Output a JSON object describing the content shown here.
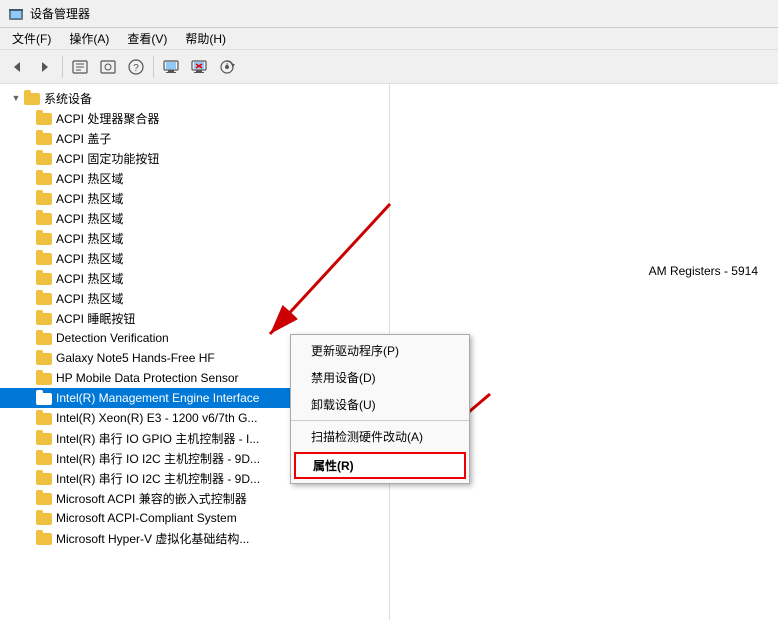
{
  "window": {
    "title": "设备管理器"
  },
  "menubar": {
    "items": [
      {
        "label": "文件(F)"
      },
      {
        "label": "操作(A)"
      },
      {
        "label": "查看(V)"
      },
      {
        "label": "帮助(H)"
      }
    ]
  },
  "toolbar": {
    "buttons": [
      "◀",
      "▶",
      "📋",
      "📄",
      "?",
      "🖥",
      "✖",
      "⬇"
    ]
  },
  "tree": {
    "root_label": "系统设备",
    "items": [
      {
        "label": "ACPI 处理器聚合器",
        "indent": 2
      },
      {
        "label": "ACPI 盖子",
        "indent": 2
      },
      {
        "label": "ACPI 固定功能按钮",
        "indent": 2
      },
      {
        "label": "ACPI 热区域",
        "indent": 2
      },
      {
        "label": "ACPI 热区域",
        "indent": 2
      },
      {
        "label": "ACPI 热区域",
        "indent": 2
      },
      {
        "label": "ACPI 热区域",
        "indent": 2
      },
      {
        "label": "ACPI 热区域",
        "indent": 2
      },
      {
        "label": "ACPI 热区域",
        "indent": 2
      },
      {
        "label": "ACPI 热区域",
        "indent": 2
      },
      {
        "label": "ACPI 睡眠按钮",
        "indent": 2
      },
      {
        "label": "Detection Verification",
        "indent": 2
      },
      {
        "label": "Galaxy Note5 Hands-Free HF",
        "indent": 2
      },
      {
        "label": "HP Mobile Data Protection Sensor",
        "indent": 2
      },
      {
        "label": "Intel(R) Management Engine Interface",
        "indent": 2,
        "selected": true
      },
      {
        "label": "Intel(R) Xeon(R) E3 - 1200 v6/7th G...",
        "indent": 2
      },
      {
        "label": "Intel(R) 串行 IO GPIO 主机控制器 - I...",
        "indent": 2
      },
      {
        "label": "Intel(R) 串行 IO I2C 主机控制器 - 9D...",
        "indent": 2
      },
      {
        "label": "Intel(R) 串行 IO I2C 主机控制器 - 9D...",
        "indent": 2
      },
      {
        "label": "Microsoft ACPI 兼容的嵌入式控制器",
        "indent": 2
      },
      {
        "label": "Microsoft ACPI-Compliant System",
        "indent": 2
      },
      {
        "label": "Microsoft Hyper-V 虚拟化基础结构...",
        "indent": 2
      }
    ]
  },
  "right_panel": {
    "text": "AM Registers - 5914"
  },
  "context_menu": {
    "items": [
      {
        "label": "更新驱动程序(P)",
        "id": "update-driver"
      },
      {
        "label": "禁用设备(D)",
        "id": "disable-device"
      },
      {
        "label": "卸载设备(U)",
        "id": "uninstall-device"
      },
      {
        "label": "扫描检测硬件改动(A)",
        "id": "scan-hardware"
      },
      {
        "label": "属性(R)",
        "id": "properties",
        "highlighted": true
      }
    ]
  }
}
